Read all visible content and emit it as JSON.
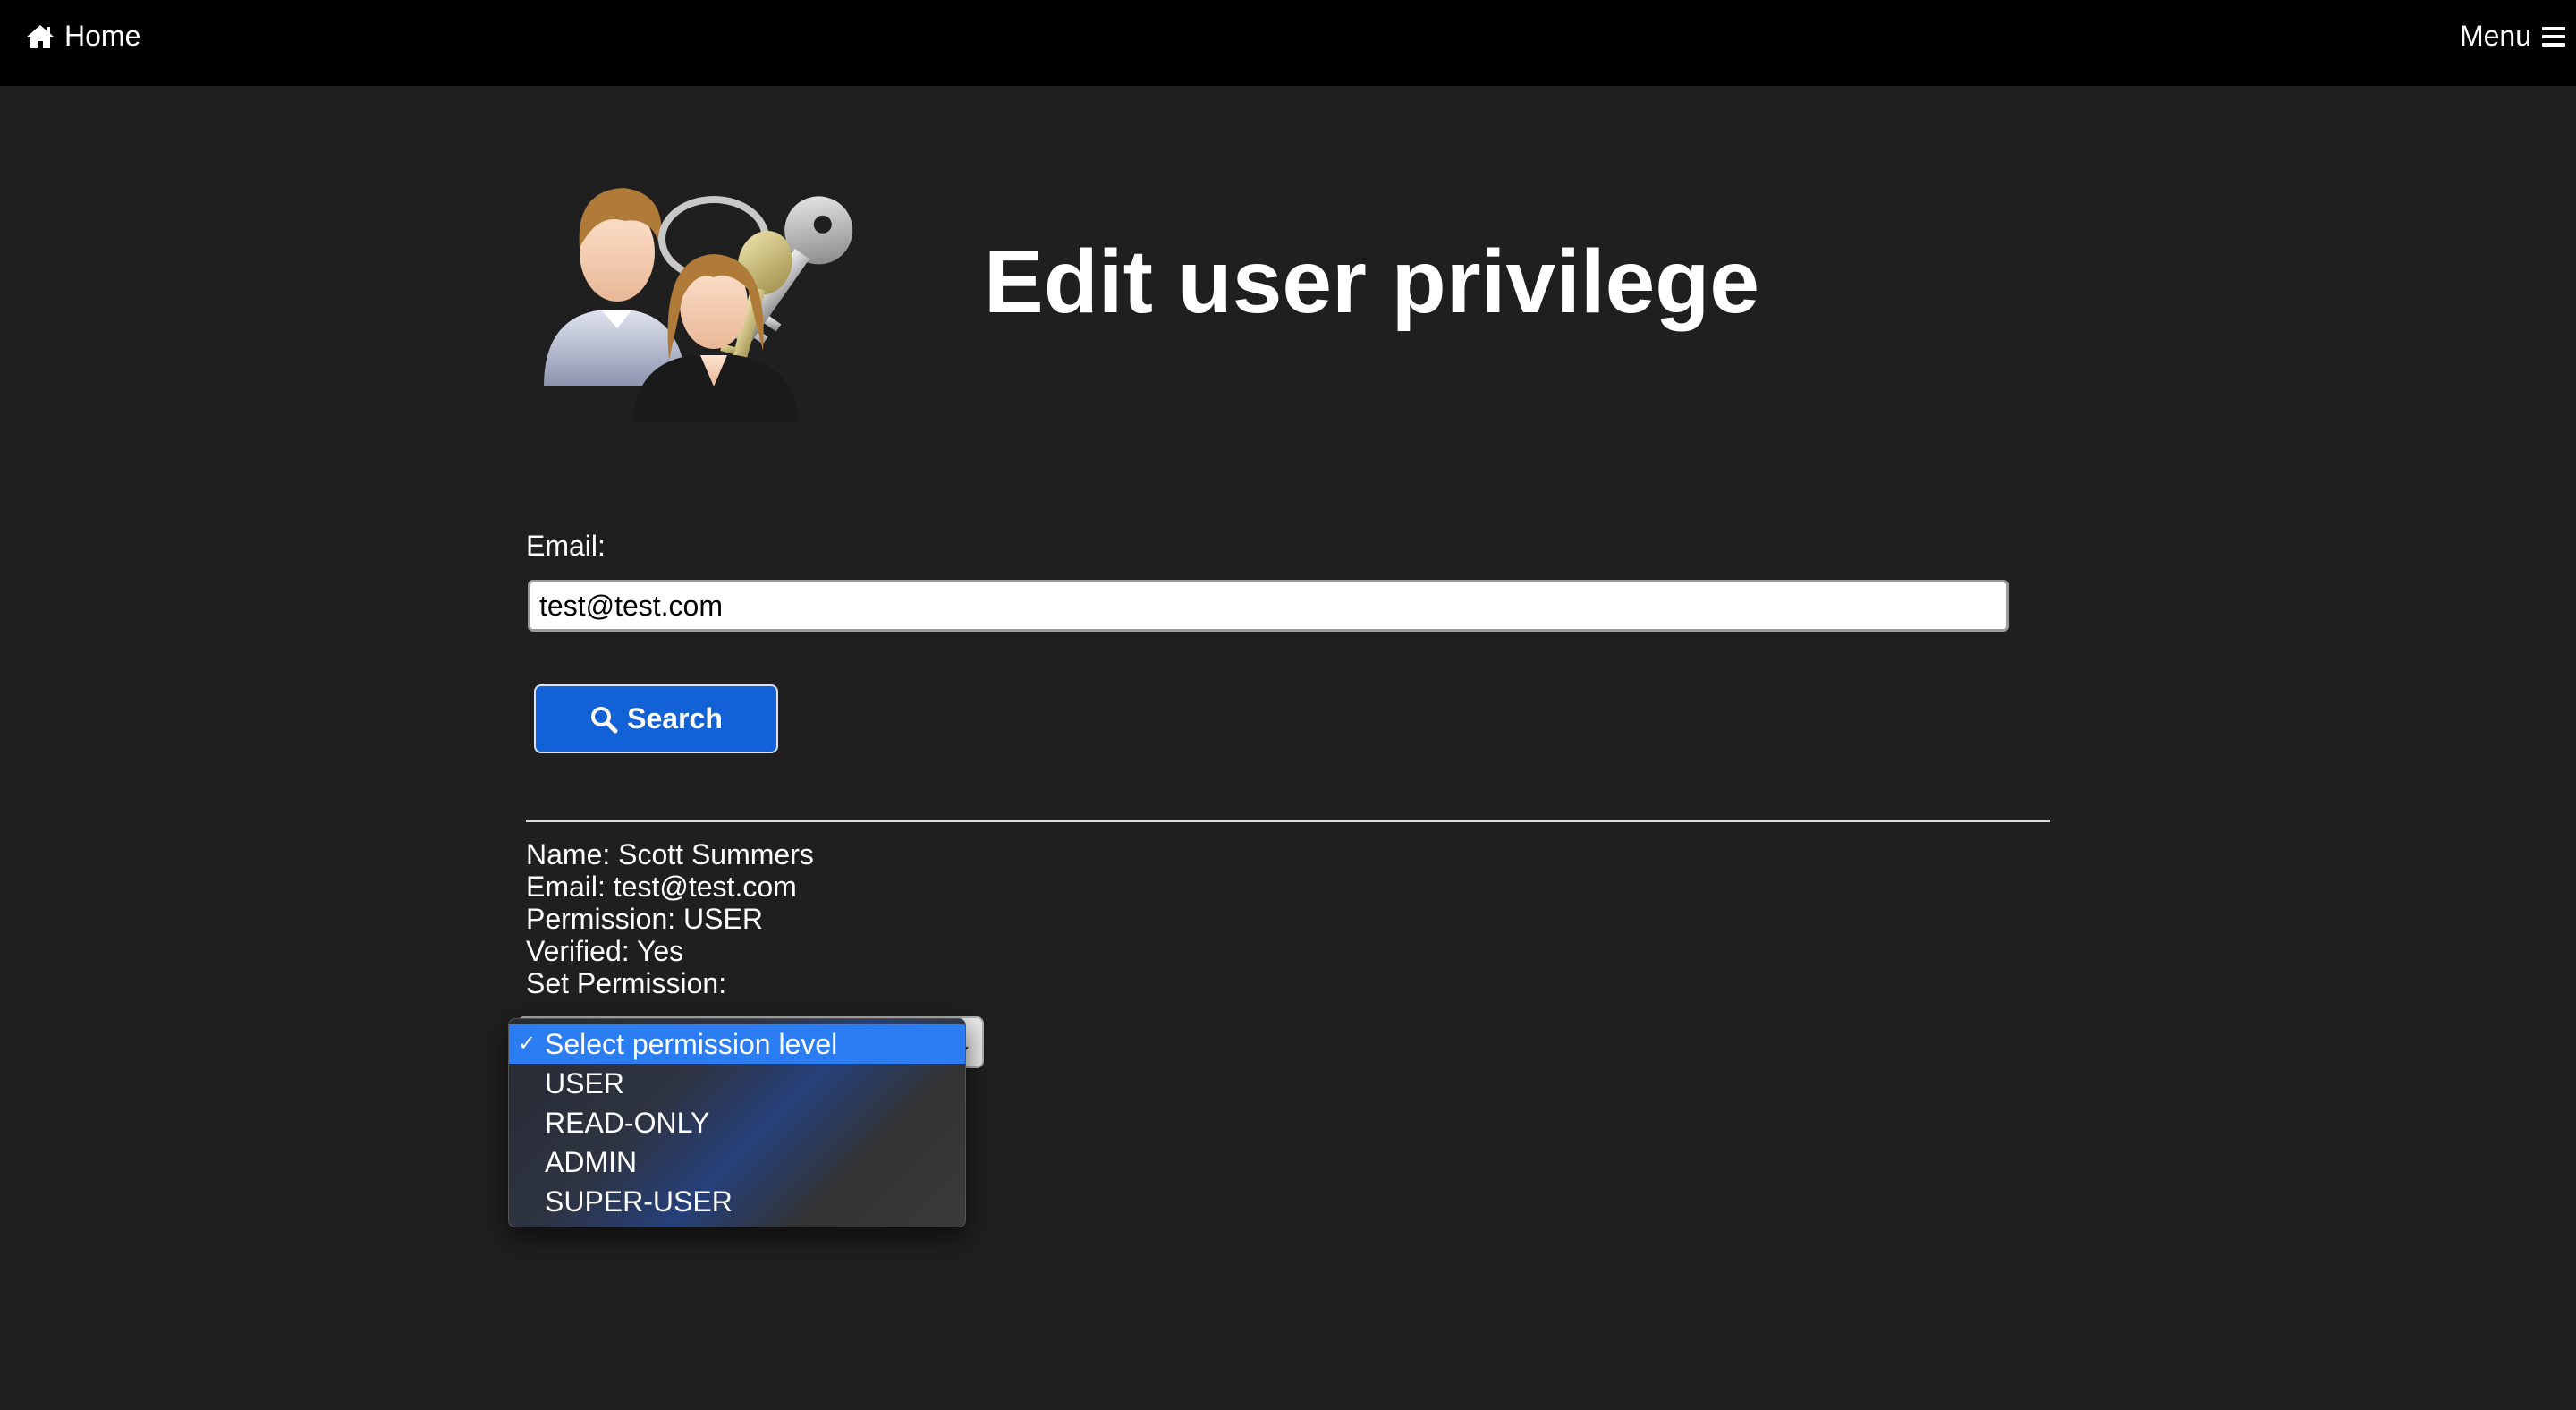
{
  "topbar": {
    "home_label": "Home",
    "menu_label": "Menu",
    "home_icon": "home-icon",
    "menu_icon": "hamburger-icon"
  },
  "page": {
    "title": "Edit user privilege"
  },
  "search_form": {
    "email_label": "Email:",
    "email_value": "test@test.com",
    "search_label": "Search",
    "search_icon": "search-icon"
  },
  "user_info": {
    "name": "Name: Scott Summers",
    "email": "Email: test@test.com",
    "permission": "Permission: USER",
    "verified": "Verified: Yes",
    "set_permission_label": "Set Permission:"
  },
  "permission_select": {
    "options": [
      {
        "label": "Select permission level",
        "selected": true
      },
      {
        "label": "USER",
        "selected": false
      },
      {
        "label": "READ-ONLY",
        "selected": false
      },
      {
        "label": "ADMIN",
        "selected": false
      },
      {
        "label": "SUPER-USER",
        "selected": false
      }
    ]
  },
  "colors": {
    "topbar_bg": "#000000",
    "page_bg": "#1f1f1f",
    "button_blue": "#1261d6",
    "selected_option": "#2d7df2"
  }
}
